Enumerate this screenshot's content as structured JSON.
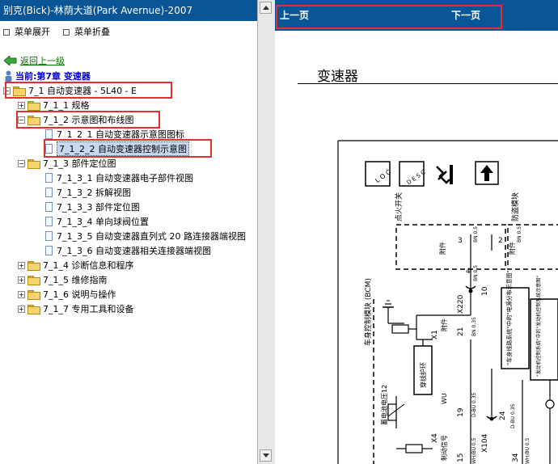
{
  "window_title": "别克(Bick)-林荫大道(Park Avernue)-2007",
  "toolbar": {
    "expand": "菜单展开",
    "collapse": "菜单折叠"
  },
  "back_link": "返回上一级",
  "current": "当前:第7章 变速器",
  "tree": {
    "root": "7_1 自动变速器 - 5L40 - E",
    "n1": "7_1_1 规格",
    "n2": "7_1_2 示意图和布线图",
    "n2a": "7_1_2_1 自动变速器示意图图标",
    "n2b": "7_1_2_2 自动变速器控制示意图",
    "n3": "7_1_3 部件定位图",
    "n3a": "7_1_3_1 自动变速器电子部件视图",
    "n3b": "7_1_3_2 拆解视图",
    "n3c": "7_1_3_3 部件定位图",
    "n3d": "7_1_3_4 单向球阀位置",
    "n3e": "7_1_3_5 自动变速器直列式 20 路连接器端视图",
    "n3f": "7_1_3_6 自动变速器相关连接器端视图",
    "n4": "7_1_4 诊断信息和程序",
    "n5": "7_1_5 维修指南",
    "n6": "7_1_6 说明与操作",
    "n7": "7_1_7 专用工具和设备"
  },
  "nav": {
    "prev": "上一页",
    "next": "下一页"
  },
  "page_heading": "变速器",
  "diagram": {
    "loc": "L O C",
    "desc": "D E S C",
    "ignition": "点火开关",
    "anti_theft": "防盗模块",
    "attach1": "附件",
    "attach2": "附件",
    "attach3": "附件",
    "pin3": "3",
    "pin2": "2",
    "pin4": "4",
    "wire_bn1": "BN 0.5",
    "wire_bn2": "BN 0.5",
    "wire_bn3": "BN 0.5",
    "x220": "X220",
    "pin10": "10",
    "bcm": "车身控制模块 (BCM)",
    "body_wiring": "\"车身线路系统\"中的\"电源分布示意图\"",
    "engine_ctrl": "\"发动机控制系统\"中的\"发动机控制系统示意图\"",
    "x1": "X1",
    "x1_21": "21",
    "x1_wire": "BN 0.35",
    "antitheft_ring": "穿线护环",
    "wu": "WU",
    "x4": "X4",
    "x4_19": "19",
    "x4_wire": "D-BU 0.35",
    "x104": "X104",
    "x104_24": "24",
    "x104_wire": "D-BU 0.35",
    "battery_label": "蓄电池电压12",
    "control_signal": "制动信号",
    "x4_15": "15",
    "wire_whbu1": "WH/BU 0.5",
    "wire_whbu2": "WH/BU 0.5",
    "x4_34": "34"
  }
}
